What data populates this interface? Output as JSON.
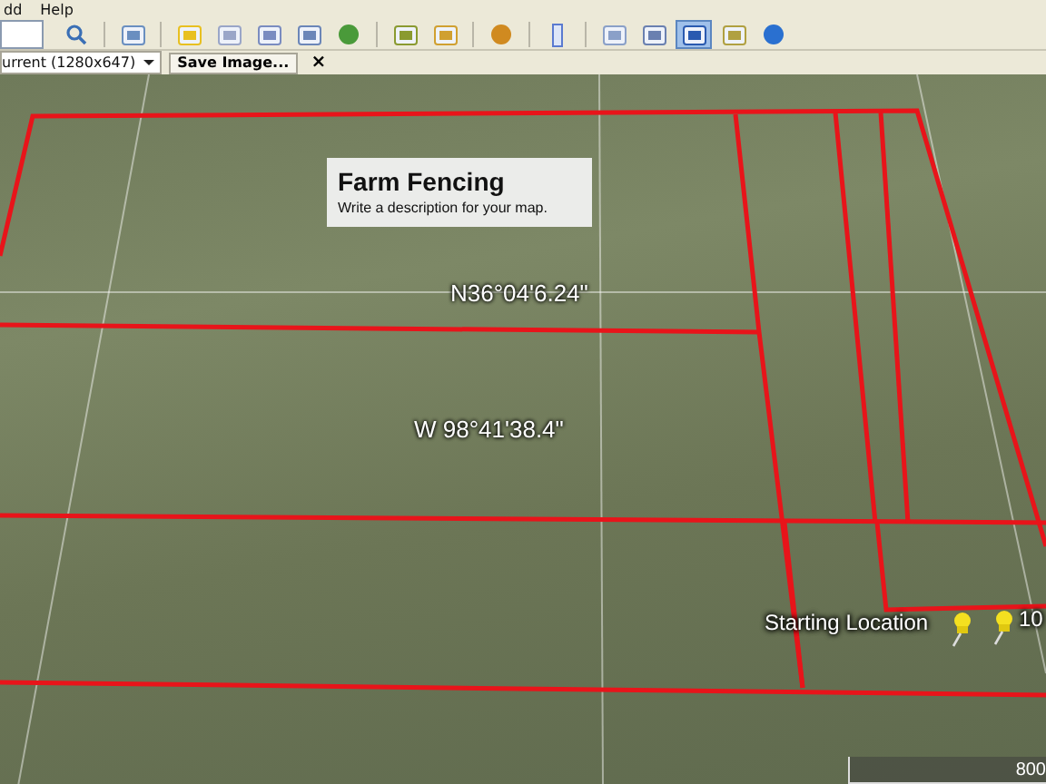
{
  "menu": [
    {
      "label": "dd"
    },
    {
      "label": "Help"
    }
  ],
  "toolbar": {
    "tools": [
      {
        "kind": "search"
      },
      {
        "kind": "panel"
      },
      {
        "kind": "pin"
      },
      {
        "kind": "polygon"
      },
      {
        "kind": "path"
      },
      {
        "kind": "overlay"
      },
      {
        "kind": "tour"
      },
      {
        "kind": "history"
      },
      {
        "kind": "sun"
      },
      {
        "kind": "planet"
      },
      {
        "kind": "ruler"
      },
      {
        "kind": "mail"
      },
      {
        "kind": "print"
      },
      {
        "kind": "save-image"
      },
      {
        "kind": "maps"
      },
      {
        "kind": "earth"
      }
    ]
  },
  "save_bar": {
    "resolution": "urrent (1280x647)",
    "button": "Save Image...",
    "close": "×"
  },
  "map": {
    "title_card": {
      "title": "Farm Fencing",
      "description": "Write a description for your map."
    },
    "labels": [
      {
        "text": "N36°04'6.24\"",
        "kind": "coordinate"
      },
      {
        "text": "W 98°41'38.4\"",
        "kind": "coordinate"
      },
      {
        "text": "Starting Location",
        "kind": "placemark"
      },
      {
        "text": "10",
        "kind": "placemark"
      }
    ],
    "scale": "800"
  }
}
